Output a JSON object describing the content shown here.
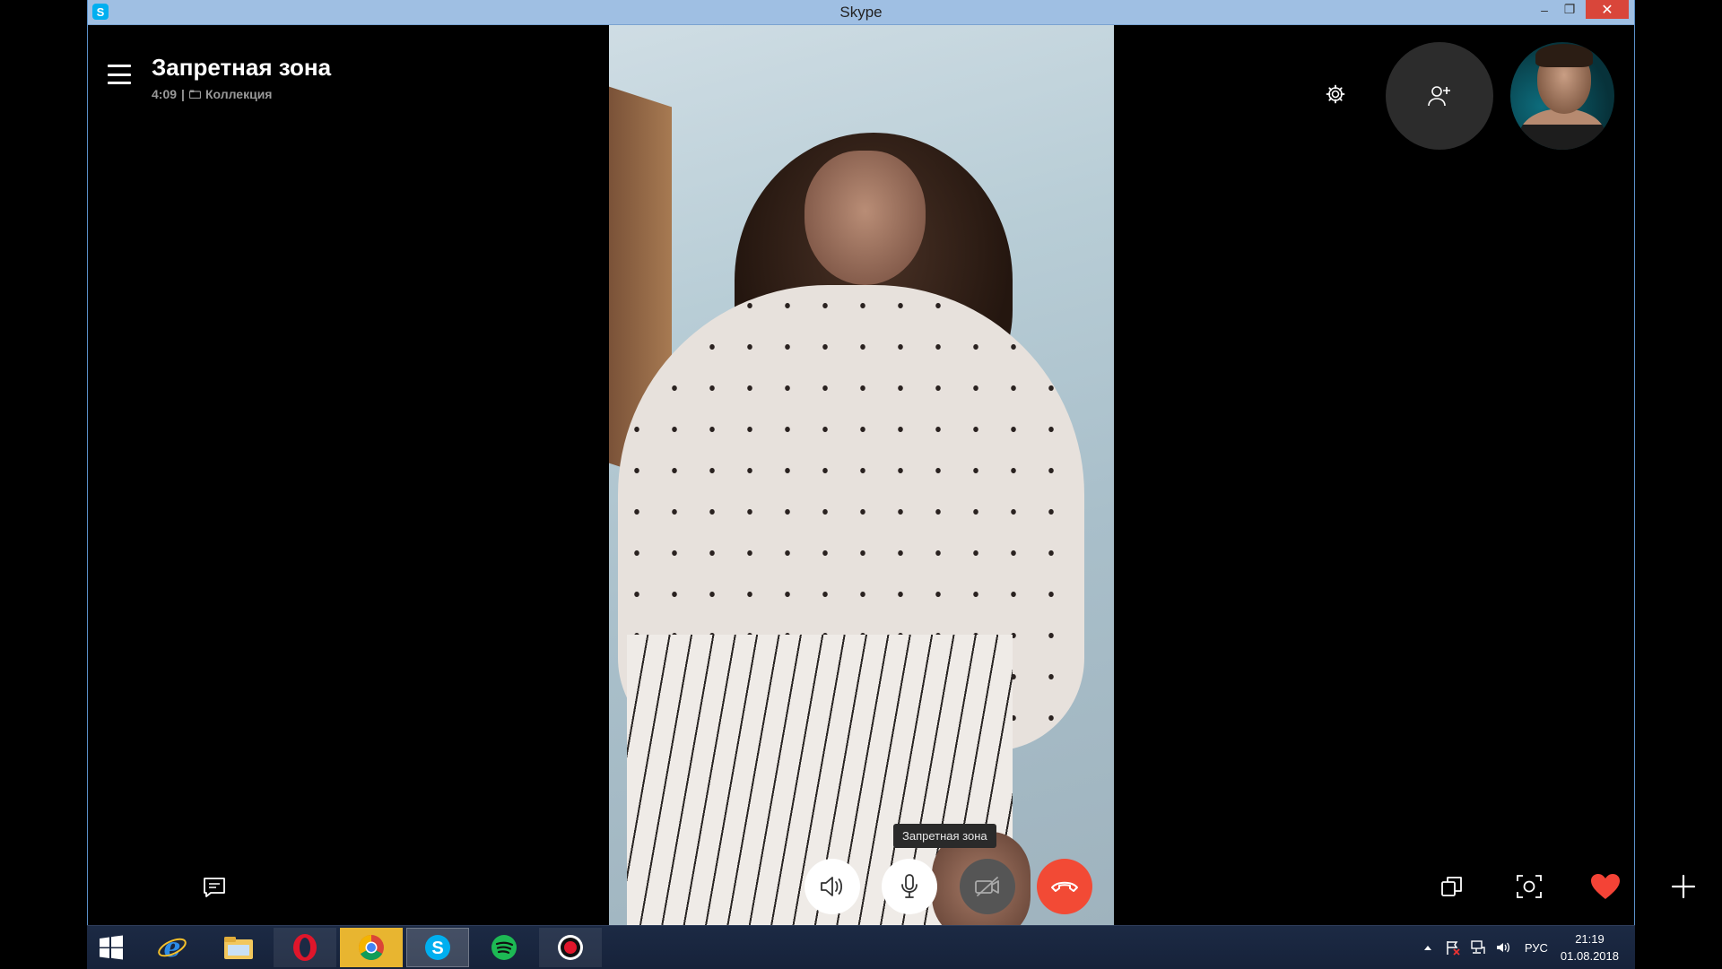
{
  "window": {
    "title": "Skype",
    "app_icon": "S",
    "minimize": "–",
    "maximize": "❐",
    "close": "✕"
  },
  "call": {
    "name": "Запретная зона",
    "duration": "4:09",
    "separator": "|",
    "group": "Коллекция",
    "tooltip": "Запретная зона"
  },
  "controls": {
    "left": [
      "chat-icon"
    ],
    "center": [
      "speaker-icon",
      "microphone-icon",
      "video-off-icon",
      "hang-up-icon"
    ],
    "right": [
      "window-icon",
      "snapshot-icon",
      "heart-icon",
      "plus-icon"
    ]
  },
  "taskbar": {
    "apps": [
      "windows-start",
      "internet-explorer",
      "file-explorer",
      "opera",
      "chrome",
      "skype",
      "spotify",
      "screen-recorder"
    ],
    "language": "РУС",
    "time": "21:19",
    "date": "01.08.2018"
  },
  "colors": {
    "titlebar": "#9fbfe3",
    "hangup": "#f24a35",
    "heart": "#f44336",
    "skype": "#00aff0",
    "taskbar": "#1c2a44"
  }
}
